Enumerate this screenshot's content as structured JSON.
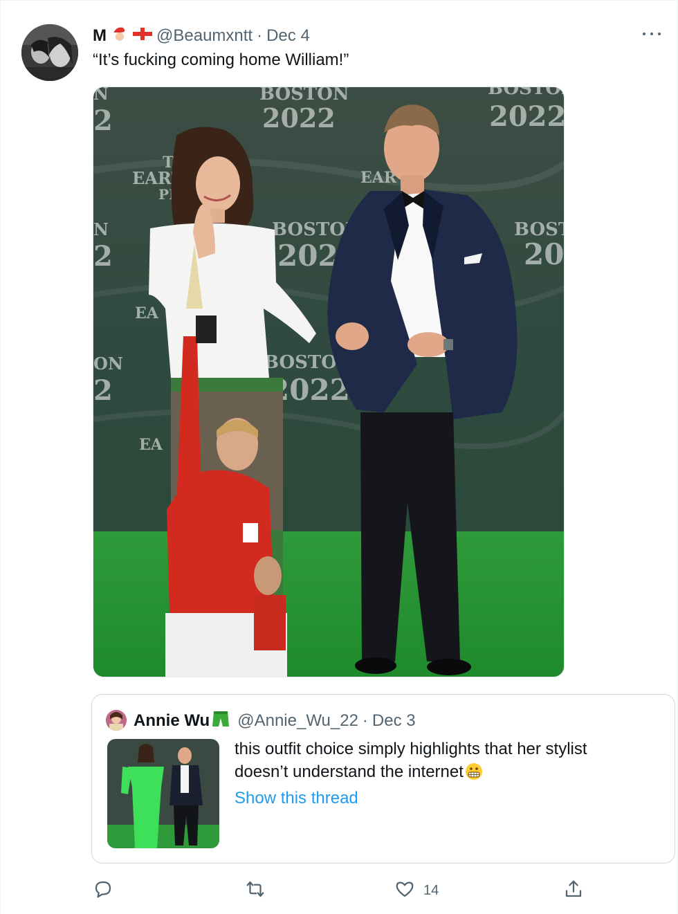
{
  "tweet": {
    "author": {
      "display_name": "M",
      "handle": "@Beaumxntt",
      "emoji": [
        "santa-emoji",
        "england-flag-emoji"
      ]
    },
    "separator": "·",
    "date": "Dec 4",
    "text": "“It’s fucking coming home William!”",
    "media": {
      "backdrop_texts": [
        "BOSTON",
        "2022",
        "BOSTON",
        "2022",
        "BOSTON",
        "2022",
        "BOSTON",
        "2022",
        "BOSTON",
        "2022",
        "EARTH",
        "THE",
        "PR",
        "EA",
        "EA",
        "EAR",
        "N",
        "2",
        "N",
        "2",
        "ON",
        "2"
      ]
    }
  },
  "quoted_tweet": {
    "author": {
      "display_name": "Annie Wu",
      "handle": "@Annie_Wu_22",
      "emoji": "green-dress-emoji"
    },
    "separator": "·",
    "date": "Dec 3",
    "text_lines": [
      "this outfit choice simply highlights that her stylist",
      "doesn’t understand the internet"
    ],
    "emoji_after_text": "grimacing-face-emoji",
    "show_thread_label": "Show this thread"
  },
  "actions": {
    "reply": {
      "icon": "reply-icon",
      "count": ""
    },
    "retweet": {
      "icon": "retweet-icon",
      "count": ""
    },
    "like": {
      "icon": "heart-icon",
      "count": "14"
    },
    "share": {
      "icon": "share-icon",
      "count": ""
    }
  },
  "colors": {
    "text_primary": "#0f1419",
    "text_secondary": "#536471",
    "link": "#1d9bf0",
    "border": "#cfd9de"
  }
}
